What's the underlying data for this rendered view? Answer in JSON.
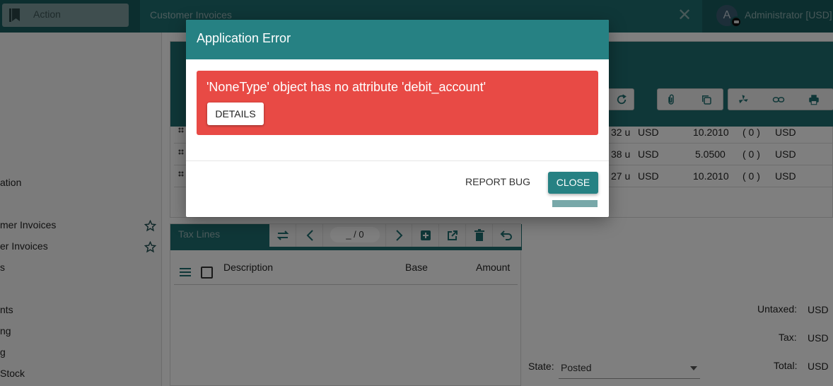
{
  "topbar": {
    "action_label": "Action",
    "tab_title": "Customer Invoices",
    "close_glyph": "✕",
    "avatar_initial": "A",
    "user_label": "Administrator [USD]"
  },
  "sidebar": {
    "items": [
      {
        "label": "ation"
      },
      {
        "label": "mer Invoices"
      },
      {
        "label": "er Invoices"
      },
      {
        "label": "s"
      },
      {
        "label": "nts"
      },
      {
        "label": "ng"
      },
      {
        "label": "g"
      },
      {
        "label": " Stock"
      }
    ]
  },
  "lines": [
    {
      "qty": "32 u",
      "currency": "USD",
      "price": "10.2010",
      "taxes": "( 0 )",
      "amount_currency": "USD"
    },
    {
      "qty": "38 u",
      "currency": "USD",
      "price": "5.0500",
      "taxes": "( 0 )",
      "amount_currency": "USD"
    },
    {
      "qty": "27 u",
      "currency": "USD",
      "price": "10.2010",
      "taxes": "( 0 )",
      "amount_currency": "USD"
    }
  ],
  "tax_lines": {
    "title": "Tax Lines",
    "page_count": "_ / 0",
    "columns": [
      "Description",
      "Base",
      "Amount"
    ]
  },
  "footer": {
    "state_label": "State:",
    "state_value": "Posted",
    "untaxed_label": "Untaxed:",
    "tax_label": "Tax:",
    "total_label": "Total:",
    "currency": "USD"
  },
  "dialog": {
    "title": "Application Error",
    "message": "'NoneType' object has no attribute 'debit_account'",
    "details_label": "DETAILS",
    "report_label": "REPORT BUG",
    "close_label": "CLOSE"
  },
  "colors": {
    "header": "#268183",
    "error": "#e84a45",
    "topbar": "#185c5e"
  }
}
